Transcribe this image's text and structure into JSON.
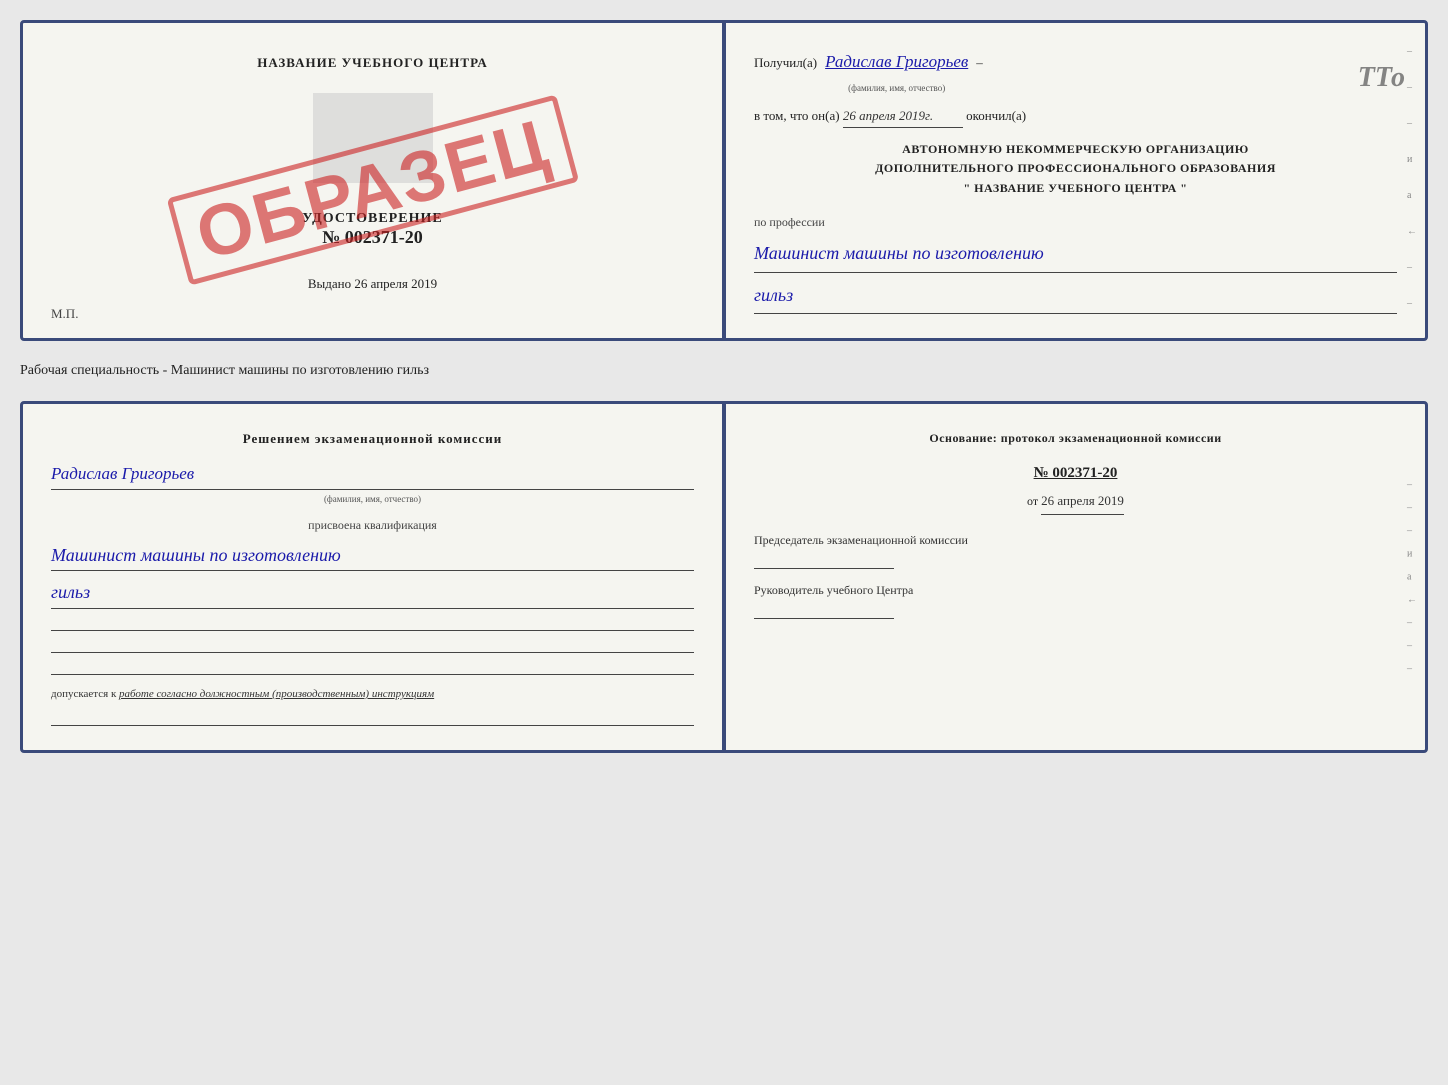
{
  "top_document": {
    "left": {
      "title": "НАЗВАНИЕ УЧЕБНОГО ЦЕНТРА",
      "stamp_text": "ОБРАЗЕЦ",
      "cert_title": "УДОСТОВЕРЕНИЕ",
      "cert_number": "№ 002371-20",
      "issued_label": "Выдано",
      "issued_date": "26 апреля 2019",
      "mp_label": "М.П."
    },
    "right": {
      "received_prefix": "Получил(а)",
      "recipient_name": "Радислав Григорьев",
      "fio_hint": "(фамилия, имя, отчество)",
      "dash": "–",
      "in_that_prefix": "в том, что он(а)",
      "date_field": "26 апреля 2019г.",
      "finished_suffix": "окончил(а)",
      "org_line1": "АВТОНОМНУЮ НЕКОММЕРЧЕСКУЮ ОРГАНИЗАЦИЮ",
      "org_line2": "ДОПОЛНИТЕЛЬНОГО ПРОФЕССИОНАЛЬНОГО ОБРАЗОВАНИЯ",
      "org_name": "\"  НАЗВАНИЕ УЧЕБНОГО ЦЕНТРА  \"",
      "profession_label": "по профессии",
      "profession_line1": "Машинист машины по изготовлению",
      "profession_line2": "гильз",
      "side_marks": [
        "–",
        "–",
        "–",
        "и",
        "а",
        "←",
        "–",
        "–",
        "–"
      ]
    }
  },
  "specialty_label": "Рабочая специальность - Машинист машины по изготовлению гильз",
  "bottom_document": {
    "left": {
      "commission_title": "Решением  экзаменационной  комиссии",
      "person_name": "Радислав Григорьев",
      "fio_hint": "(фамилия, имя, отчество)",
      "assigned_label": "присвоена квалификация",
      "qualification_line1": "Машинист машины по изготовлению",
      "qualification_line2": "гильз",
      "admission_text": "допускается к",
      "admission_underline": "работе согласно должностным (производственным) инструкциям"
    },
    "right": {
      "basis_title": "Основание: протокол экзаменационной  комиссии",
      "protocol_number": "№ 002371-20",
      "date_prefix": "от",
      "protocol_date": "26 апреля 2019",
      "chairman_label": "Председатель экзаменационной комиссии",
      "director_label": "Руководитель учебного Центра",
      "side_marks": [
        "–",
        "–",
        "–",
        "и",
        "а",
        "←",
        "–",
        "–",
        "–"
      ]
    }
  },
  "tto_stamp": "ТТо"
}
